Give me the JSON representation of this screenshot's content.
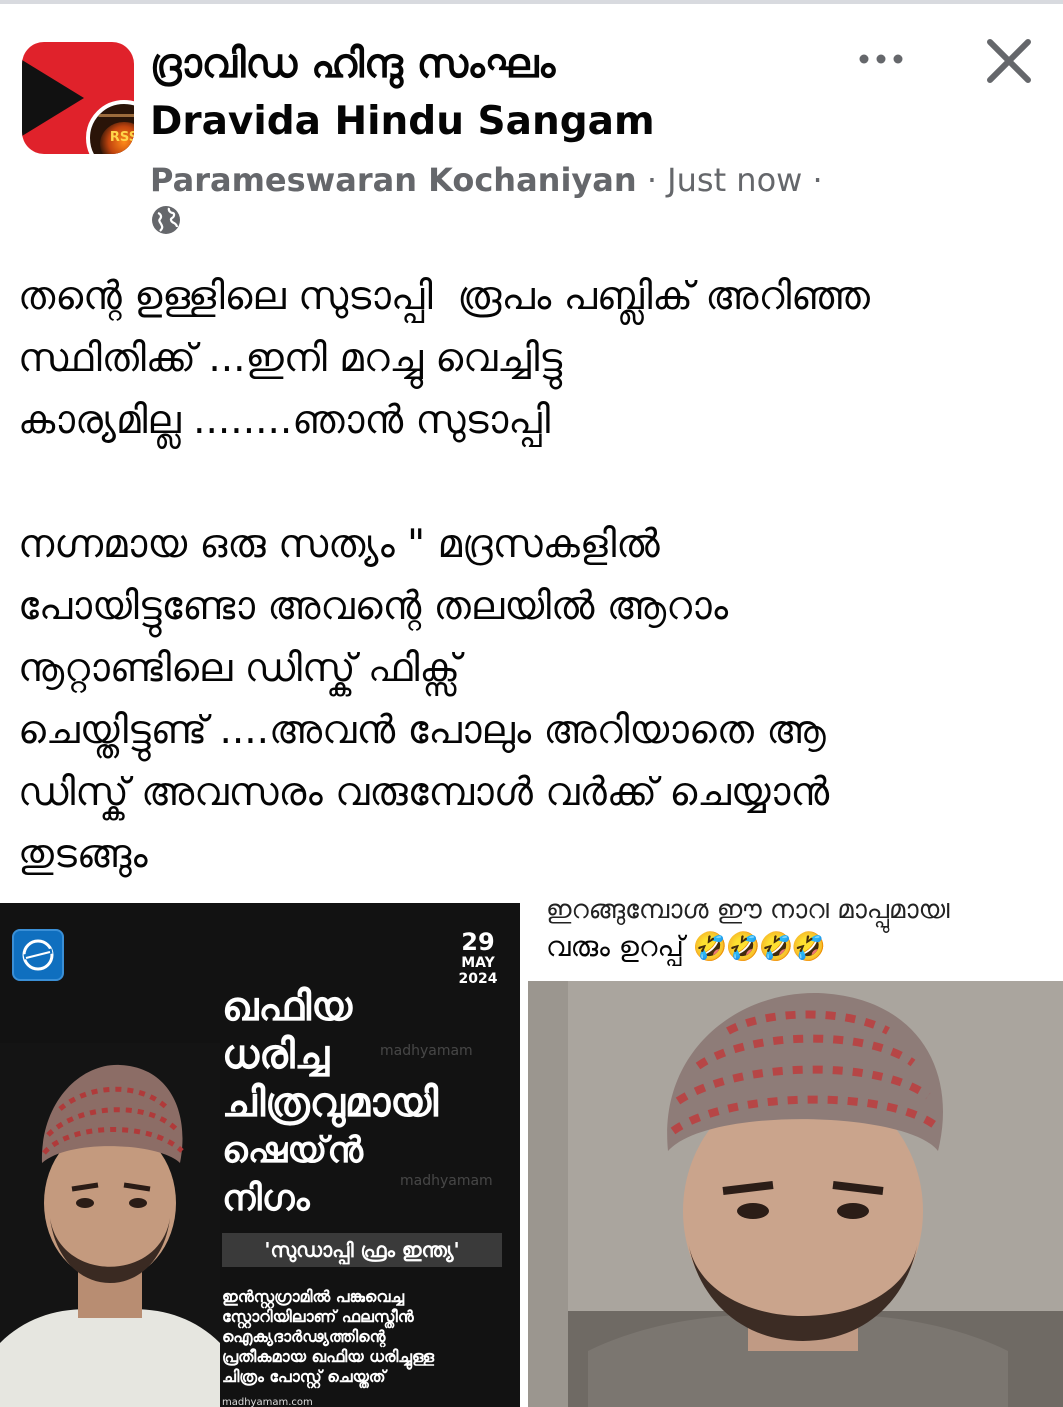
{
  "header": {
    "group_name_ml": "ദ്രാവിഡ ഹിന്ദു സംഘം",
    "group_name_en": "Dravida Hindu Sangam",
    "author": "Parameswaran Kochaniyan",
    "time": "Just now",
    "separator": "·",
    "privacy_icon": "globe-icon",
    "more_icon": "more-options-icon",
    "close_icon": "close-icon",
    "avatar_badge_text": "RSS"
  },
  "post": {
    "paragraph1": [
      "തന്റെ ഉള്ളിലെ സുടാപ്പി  രൂപം പബ്ലിക് അറിഞ്ഞ",
      "സ്ഥിതിക്ക് ...ഇനി മറച്ചു വെച്ചിട്ടു",
      "കാര്യമില്ല ........ഞാൻ സുടാപ്പി"
    ],
    "paragraph2": [
      "നഗ്നമായ ഒരു സത്യം \" മദ്രസകളിൽ",
      "പോയിട്ടുണ്ടോ അവന്റെ തലയിൽ ആറാം",
      "നൂറ്റാണ്ടിലെ ഡിസ്ക് ഫിക്സ്",
      "ചെയ്തിട്ടുണ്ട് ....അവൻ പോലും അറിയാതെ ആ",
      "ഡിസ്ക് അവസരം വരുമ്പോൾ വർക്ക് ചെയ്യാൻ",
      "തുടങ്ങും"
    ]
  },
  "image_left": {
    "date_day": "29",
    "date_month": "MAY",
    "date_year": "2024",
    "headline": [
      "ഖഫിയ",
      "ധരിച്ച",
      "ചിത്രവുമായി",
      "ഷെയ്ൻ",
      "നിഗം"
    ],
    "strap": "'സുഡാപ്പി ഫ്രം ഇന്ത്യ'",
    "caption": [
      "ഇൻസ്റ്റഗ്രാമിൽ പങ്കുവെച്ച",
      "സ്റ്റോറിയിലാണ് ഫലസ്തീൻ",
      "ഐക്യദാർഢ്യത്തിന്റെ",
      "പ്രതീകമായ ഖഫിയ ധരിച്ചുള്ള",
      "ചിത്രം പോസ്റ്റ് ചെയ്തത്"
    ],
    "watermark": "madhyamam",
    "footer": "madhyamam.com"
  },
  "image_right": {
    "caption_partial": "ഇറങ്ങുമ്പോൾ ഈ നാറി മാപ്പുമായി",
    "caption": "വരും ഉറപ്പ്",
    "emojis": "🤣🤣🤣🤣"
  },
  "colors": {
    "meta_gray": "#65676b",
    "avatar_red": "#e0222b",
    "news_bg": "#121212"
  }
}
